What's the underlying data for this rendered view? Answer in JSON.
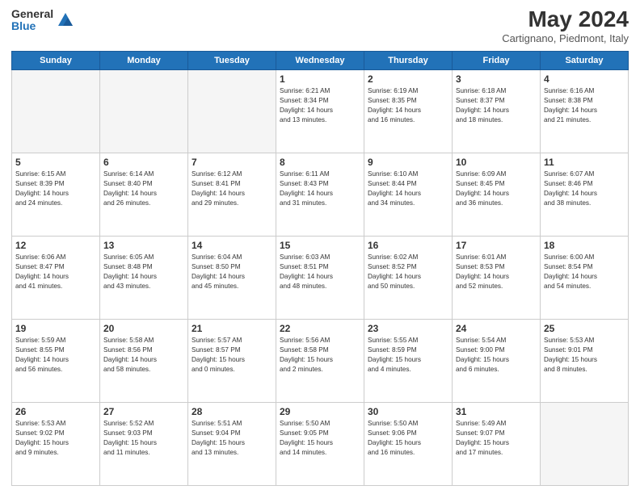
{
  "header": {
    "logo_general": "General",
    "logo_blue": "Blue",
    "title": "May 2024",
    "location": "Cartignano, Piedmont, Italy"
  },
  "weekdays": [
    "Sunday",
    "Monday",
    "Tuesday",
    "Wednesday",
    "Thursday",
    "Friday",
    "Saturday"
  ],
  "weeks": [
    [
      {
        "day": "",
        "info": ""
      },
      {
        "day": "",
        "info": ""
      },
      {
        "day": "",
        "info": ""
      },
      {
        "day": "1",
        "info": "Sunrise: 6:21 AM\nSunset: 8:34 PM\nDaylight: 14 hours\nand 13 minutes."
      },
      {
        "day": "2",
        "info": "Sunrise: 6:19 AM\nSunset: 8:35 PM\nDaylight: 14 hours\nand 16 minutes."
      },
      {
        "day": "3",
        "info": "Sunrise: 6:18 AM\nSunset: 8:37 PM\nDaylight: 14 hours\nand 18 minutes."
      },
      {
        "day": "4",
        "info": "Sunrise: 6:16 AM\nSunset: 8:38 PM\nDaylight: 14 hours\nand 21 minutes."
      }
    ],
    [
      {
        "day": "5",
        "info": "Sunrise: 6:15 AM\nSunset: 8:39 PM\nDaylight: 14 hours\nand 24 minutes."
      },
      {
        "day": "6",
        "info": "Sunrise: 6:14 AM\nSunset: 8:40 PM\nDaylight: 14 hours\nand 26 minutes."
      },
      {
        "day": "7",
        "info": "Sunrise: 6:12 AM\nSunset: 8:41 PM\nDaylight: 14 hours\nand 29 minutes."
      },
      {
        "day": "8",
        "info": "Sunrise: 6:11 AM\nSunset: 8:43 PM\nDaylight: 14 hours\nand 31 minutes."
      },
      {
        "day": "9",
        "info": "Sunrise: 6:10 AM\nSunset: 8:44 PM\nDaylight: 14 hours\nand 34 minutes."
      },
      {
        "day": "10",
        "info": "Sunrise: 6:09 AM\nSunset: 8:45 PM\nDaylight: 14 hours\nand 36 minutes."
      },
      {
        "day": "11",
        "info": "Sunrise: 6:07 AM\nSunset: 8:46 PM\nDaylight: 14 hours\nand 38 minutes."
      }
    ],
    [
      {
        "day": "12",
        "info": "Sunrise: 6:06 AM\nSunset: 8:47 PM\nDaylight: 14 hours\nand 41 minutes."
      },
      {
        "day": "13",
        "info": "Sunrise: 6:05 AM\nSunset: 8:48 PM\nDaylight: 14 hours\nand 43 minutes."
      },
      {
        "day": "14",
        "info": "Sunrise: 6:04 AM\nSunset: 8:50 PM\nDaylight: 14 hours\nand 45 minutes."
      },
      {
        "day": "15",
        "info": "Sunrise: 6:03 AM\nSunset: 8:51 PM\nDaylight: 14 hours\nand 48 minutes."
      },
      {
        "day": "16",
        "info": "Sunrise: 6:02 AM\nSunset: 8:52 PM\nDaylight: 14 hours\nand 50 minutes."
      },
      {
        "day": "17",
        "info": "Sunrise: 6:01 AM\nSunset: 8:53 PM\nDaylight: 14 hours\nand 52 minutes."
      },
      {
        "day": "18",
        "info": "Sunrise: 6:00 AM\nSunset: 8:54 PM\nDaylight: 14 hours\nand 54 minutes."
      }
    ],
    [
      {
        "day": "19",
        "info": "Sunrise: 5:59 AM\nSunset: 8:55 PM\nDaylight: 14 hours\nand 56 minutes."
      },
      {
        "day": "20",
        "info": "Sunrise: 5:58 AM\nSunset: 8:56 PM\nDaylight: 14 hours\nand 58 minutes."
      },
      {
        "day": "21",
        "info": "Sunrise: 5:57 AM\nSunset: 8:57 PM\nDaylight: 15 hours\nand 0 minutes."
      },
      {
        "day": "22",
        "info": "Sunrise: 5:56 AM\nSunset: 8:58 PM\nDaylight: 15 hours\nand 2 minutes."
      },
      {
        "day": "23",
        "info": "Sunrise: 5:55 AM\nSunset: 8:59 PM\nDaylight: 15 hours\nand 4 minutes."
      },
      {
        "day": "24",
        "info": "Sunrise: 5:54 AM\nSunset: 9:00 PM\nDaylight: 15 hours\nand 6 minutes."
      },
      {
        "day": "25",
        "info": "Sunrise: 5:53 AM\nSunset: 9:01 PM\nDaylight: 15 hours\nand 8 minutes."
      }
    ],
    [
      {
        "day": "26",
        "info": "Sunrise: 5:53 AM\nSunset: 9:02 PM\nDaylight: 15 hours\nand 9 minutes."
      },
      {
        "day": "27",
        "info": "Sunrise: 5:52 AM\nSunset: 9:03 PM\nDaylight: 15 hours\nand 11 minutes."
      },
      {
        "day": "28",
        "info": "Sunrise: 5:51 AM\nSunset: 9:04 PM\nDaylight: 15 hours\nand 13 minutes."
      },
      {
        "day": "29",
        "info": "Sunrise: 5:50 AM\nSunset: 9:05 PM\nDaylight: 15 hours\nand 14 minutes."
      },
      {
        "day": "30",
        "info": "Sunrise: 5:50 AM\nSunset: 9:06 PM\nDaylight: 15 hours\nand 16 minutes."
      },
      {
        "day": "31",
        "info": "Sunrise: 5:49 AM\nSunset: 9:07 PM\nDaylight: 15 hours\nand 17 minutes."
      },
      {
        "day": "",
        "info": ""
      }
    ]
  ]
}
